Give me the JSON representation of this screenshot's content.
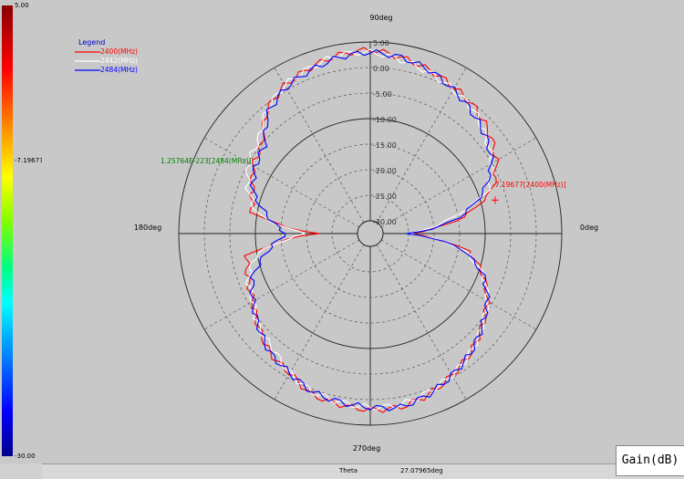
{
  "colorbar": {
    "max_label": "5.00",
    "mid_label": "-7.19677",
    "min_label": "-30.00"
  },
  "status": {
    "theta_label": "Theta",
    "theta_value": "27.07965deg"
  },
  "gain_label": "Gain(dB)",
  "chart_data": {
    "type": "polar",
    "angle_labels": {
      "top": "90deg",
      "left": "180deg",
      "right": "0deg",
      "bottom": "270deg"
    },
    "radial_ticks": [
      "5.00",
      "0.00",
      "-5.00",
      "-10.00",
      "-15.00",
      "-20.00",
      "-25.00",
      "-30.00"
    ],
    "rlim": [
      -30,
      5
    ],
    "grid": true,
    "legend": {
      "title": "Legend",
      "placement": "top-left",
      "entries": [
        "2400(MHz)",
        "2442(MHz)",
        "2484(MHz)"
      ]
    },
    "annotations": [
      {
        "text": "-7.19677[2400(MHz)]",
        "series": "2400(MHz)",
        "angle": 15,
        "value": -7.2,
        "color": "#ff0000"
      },
      {
        "text": "1.25764E-223[2484(MHz)]",
        "series": "2484(MHz)",
        "angle": 160,
        "value": -7.5,
        "color": "#008000"
      }
    ],
    "theta_deg": [
      0,
      10,
      20,
      30,
      40,
      50,
      60,
      70,
      80,
      90,
      100,
      110,
      120,
      130,
      140,
      150,
      160,
      170,
      180,
      190,
      200,
      210,
      220,
      230,
      240,
      250,
      260,
      270,
      280,
      290,
      300,
      310,
      320,
      330,
      340,
      350
    ],
    "series": [
      {
        "name": "2400(MHz)",
        "color": "#ff0000",
        "values": [
          -25,
          -14,
          -7,
          -4,
          -2,
          -0.5,
          0.5,
          1.5,
          2.5,
          3.5,
          3,
          2,
          1,
          -1,
          -5,
          -6,
          -8,
          -9,
          -22,
          -8,
          -7,
          -6,
          -4,
          -2,
          -1,
          1,
          1.5,
          2,
          2,
          1,
          -0.5,
          -2,
          -4,
          -6,
          -9,
          -13
        ]
      },
      {
        "name": "2442(MHz)",
        "color": "#ffffff",
        "values": [
          -25,
          -17,
          -8,
          -5,
          -3,
          -1,
          0,
          1,
          2,
          3,
          3,
          2,
          1,
          -1,
          -4,
          -5,
          -7,
          -10,
          -20,
          -10,
          -7,
          -6,
          -4,
          -3,
          -1,
          0.5,
          1,
          1.5,
          1.5,
          0.5,
          -0.5,
          -2,
          -4,
          -6,
          -9,
          -14
        ]
      },
      {
        "name": "2484(MHz)",
        "color": "#0000ff",
        "values": [
          -25,
          -15,
          -9,
          -5,
          -3,
          -1.5,
          0,
          1.5,
          2.5,
          3,
          2.5,
          1.5,
          0.5,
          -1.5,
          -5.5,
          -6.5,
          -8,
          -12,
          -16,
          -12,
          -8,
          -6,
          -4,
          -2,
          -1,
          0.5,
          1,
          1.5,
          2,
          1,
          -0.5,
          -2,
          -4,
          -6,
          -9,
          -14
        ]
      }
    ]
  }
}
